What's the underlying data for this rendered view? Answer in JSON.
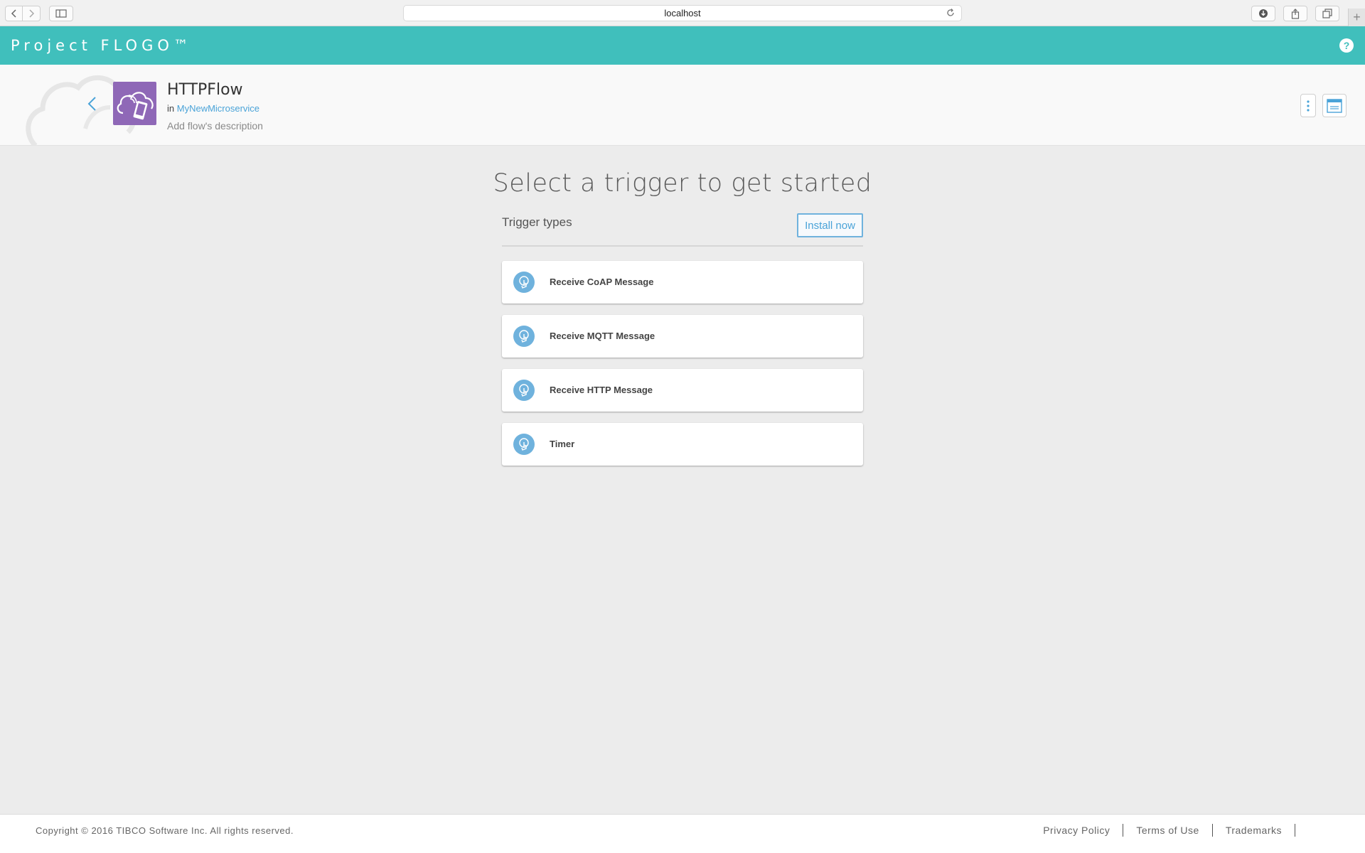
{
  "browser": {
    "url": "localhost"
  },
  "app": {
    "brand": "Project FLOGO™",
    "help_label": "?"
  },
  "flow": {
    "name": "HTTPFlow",
    "in_label": "in",
    "app_name": "MyNewMicroservice",
    "description_placeholder": "Add flow's description",
    "icon_color": "#8f68b7"
  },
  "main": {
    "title": "Select a trigger to get started",
    "trigger_types_label": "Trigger types",
    "install_label": "Install now",
    "triggers": [
      {
        "label": "Receive CoAP Message"
      },
      {
        "label": "Receive MQTT Message"
      },
      {
        "label": "Receive HTTP Message"
      },
      {
        "label": "Timer"
      }
    ]
  },
  "footer": {
    "copyright": "Copyright © 2016 TIBCO Software Inc. All rights reserved.",
    "links": [
      {
        "label": "Privacy Policy"
      },
      {
        "label": "Terms of Use"
      },
      {
        "label": "Trademarks"
      }
    ]
  },
  "colors": {
    "accent": "#40bfbc",
    "link": "#4aa3d8",
    "trigger_icon": "#6fb2dd"
  }
}
